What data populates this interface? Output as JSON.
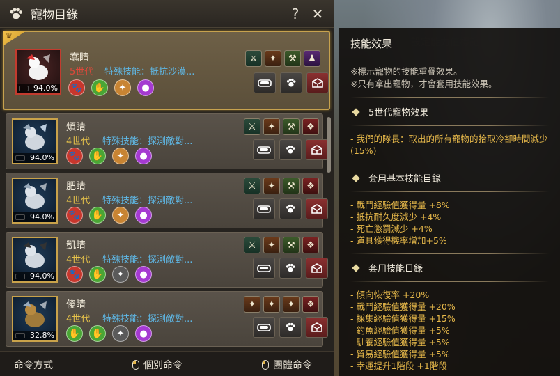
{
  "window": {
    "title": "寵物目錄",
    "help_label": "?",
    "close_label": "✕"
  },
  "pets": [
    {
      "name": "蠢睛",
      "generation": "5世代",
      "special_skill": "特殊技能：抵抗沙漠...",
      "percent": "94.0%",
      "selected": true,
      "traits": [
        "red",
        "green",
        "orange",
        "purple"
      ],
      "skills": [
        "teal",
        "orange",
        "green",
        "purple"
      ]
    },
    {
      "name": "煩睛",
      "generation": "4世代",
      "special_skill": "特殊技能：探測敵對...",
      "percent": "94.0%",
      "selected": false,
      "traits": [
        "red",
        "green",
        "orange",
        "purple"
      ],
      "skills": [
        "teal",
        "orange",
        "green",
        "red"
      ]
    },
    {
      "name": "肥睛",
      "generation": "4世代",
      "special_skill": "特殊技能：探測敵對...",
      "percent": "94.0%",
      "selected": false,
      "traits": [
        "red",
        "green",
        "orange",
        "purple"
      ],
      "skills": [
        "teal",
        "orange",
        "green",
        "red"
      ]
    },
    {
      "name": "凱睛",
      "generation": "4世代",
      "special_skill": "特殊技能：探測敵對...",
      "percent": "94.0%",
      "selected": false,
      "traits": [
        "red",
        "green",
        "gray",
        "purple"
      ],
      "skills": [
        "teal",
        "orange",
        "green",
        "red"
      ]
    },
    {
      "name": "傻睛",
      "generation": "4世代",
      "special_skill": "特殊技能：探測敵對...",
      "percent": "32.8%",
      "selected": false,
      "traits": [
        "green",
        "green",
        "gray",
        "purple"
      ],
      "skills": [
        "orange",
        "orange",
        "orange",
        "red"
      ]
    }
  ],
  "footer": {
    "command_method": "命令方式",
    "individual_command": "個別命令",
    "group_command": "團體命令"
  },
  "skill_panel": {
    "title": "技能效果",
    "notes": [
      "※標示寵物的技能重疊效果。",
      "※只有拿出寵物，才會套用技能效果。"
    ],
    "sections": [
      {
        "heading": "5世代寵物效果",
        "effects": [
          "- 我們的隊長：取出的所有寵物的拾取冷卻時間減少(15%)"
        ]
      },
      {
        "heading": "套用基本技能目錄",
        "effects": [
          "- 戰鬥經驗值獲得量 +8%",
          "- 抵抗耐久度減少 +4%",
          "- 死亡懲罰減少 +4%",
          "- 道具獲得機率增加+5%"
        ]
      },
      {
        "heading": "套用技能目錄",
        "effects": [
          "- 傾向恢復率 +20%",
          "- 戰鬥經驗值獲得量 +20%",
          "- 採集經驗值獲得量 +15%",
          "- 釣魚經驗值獲得量 +5%",
          "- 馴養經驗值獲得量 +5%",
          "- 貿易經驗值獲得量 +5%",
          "- 幸運提升1階段 +1階段"
        ]
      }
    ]
  },
  "colors": {
    "accent_gold": "#c7a24e",
    "generation_yellow": "#e6c24a",
    "generation_red": "#e0483a",
    "skill_blue": "#5fb8e6",
    "effect_gold": "#e6b84a"
  }
}
